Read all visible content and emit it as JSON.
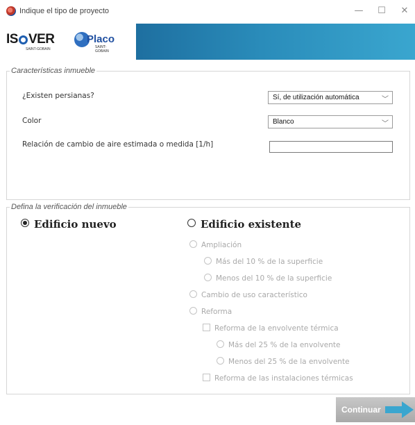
{
  "window": {
    "title": "Indique el tipo de proyecto",
    "minimize": "—",
    "maximize": "☐",
    "close": "✕"
  },
  "header": {
    "isover_logo": "ISOVER",
    "isover_sub": "SAINT-GOBAIN",
    "placo_logo": "Placo",
    "placo_sub": "SAINT-GOBAIN"
  },
  "caracteristicas": {
    "legend": "Características inmueble",
    "persianas_label": "¿Existen persianas?",
    "persianas_value": "Sí, de utilización automática",
    "color_label": "Color",
    "color_value": "Blanco",
    "aire_label": "Relación de cambio de aire estimada o medida [1/h]",
    "aire_value": ""
  },
  "verificacion": {
    "legend": "Defina la verificación del inmueble",
    "nuevo": "Edificio nuevo",
    "existente": "Edificio existente",
    "ampliacion": "Ampliación",
    "mas10": "Más del 10 % de la superficie",
    "menos10": "Menos del 10 % de la superficie",
    "cambio_uso": "Cambio de uso característico",
    "reforma": "Reforma",
    "reforma_envolvente": "Reforma de la envolvente térmica",
    "mas25": "Más del 25 % de la envolvente",
    "menos25": "Menos del 25 % de la envolvente",
    "reforma_instalaciones": "Reforma de las instalaciones térmicas"
  },
  "actions": {
    "continue_label": "Continuar"
  },
  "colors": {
    "header_band": "#2a8cba",
    "arrow": "#3aa6cf",
    "disabled_text": "#a9a9a9"
  }
}
